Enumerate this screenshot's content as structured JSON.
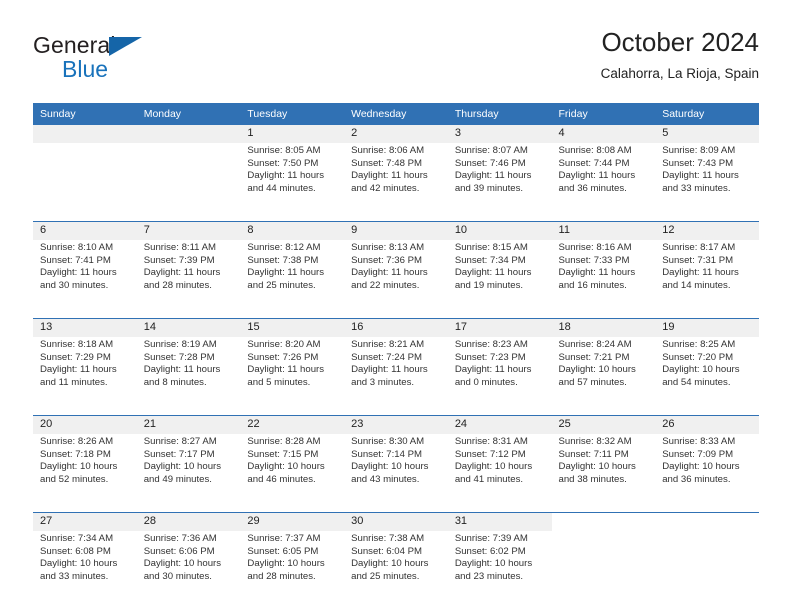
{
  "brand": {
    "word_one": "General",
    "word_two": "Blue",
    "triangle_icon": "triangle-icon",
    "colors": {
      "blue": "#1872bb",
      "triangle": "#1565a8",
      "dark": "#231f20"
    }
  },
  "header": {
    "title": "October 2024",
    "subtitle": "Calahorra, La Rioja, Spain"
  },
  "theme": {
    "header_blue": "#3071b4",
    "daynum_band": "#f0f0f0",
    "text": "#333333",
    "page_bg": "#ffffff"
  },
  "calendar": {
    "weekday_headers": [
      "Sunday",
      "Monday",
      "Tuesday",
      "Wednesday",
      "Thursday",
      "Friday",
      "Saturday"
    ],
    "weeks": [
      [
        {
          "day": "",
          "lines": []
        },
        {
          "day": "",
          "lines": []
        },
        {
          "day": "1",
          "lines": [
            "Sunrise: 8:05 AM",
            "Sunset: 7:50 PM",
            "Daylight: 11 hours",
            "and 44 minutes."
          ]
        },
        {
          "day": "2",
          "lines": [
            "Sunrise: 8:06 AM",
            "Sunset: 7:48 PM",
            "Daylight: 11 hours",
            "and 42 minutes."
          ]
        },
        {
          "day": "3",
          "lines": [
            "Sunrise: 8:07 AM",
            "Sunset: 7:46 PM",
            "Daylight: 11 hours",
            "and 39 minutes."
          ]
        },
        {
          "day": "4",
          "lines": [
            "Sunrise: 8:08 AM",
            "Sunset: 7:44 PM",
            "Daylight: 11 hours",
            "and 36 minutes."
          ]
        },
        {
          "day": "5",
          "lines": [
            "Sunrise: 8:09 AM",
            "Sunset: 7:43 PM",
            "Daylight: 11 hours",
            "and 33 minutes."
          ]
        }
      ],
      [
        {
          "day": "6",
          "lines": [
            "Sunrise: 8:10 AM",
            "Sunset: 7:41 PM",
            "Daylight: 11 hours",
            "and 30 minutes."
          ]
        },
        {
          "day": "7",
          "lines": [
            "Sunrise: 8:11 AM",
            "Sunset: 7:39 PM",
            "Daylight: 11 hours",
            "and 28 minutes."
          ]
        },
        {
          "day": "8",
          "lines": [
            "Sunrise: 8:12 AM",
            "Sunset: 7:38 PM",
            "Daylight: 11 hours",
            "and 25 minutes."
          ]
        },
        {
          "day": "9",
          "lines": [
            "Sunrise: 8:13 AM",
            "Sunset: 7:36 PM",
            "Daylight: 11 hours",
            "and 22 minutes."
          ]
        },
        {
          "day": "10",
          "lines": [
            "Sunrise: 8:15 AM",
            "Sunset: 7:34 PM",
            "Daylight: 11 hours",
            "and 19 minutes."
          ]
        },
        {
          "day": "11",
          "lines": [
            "Sunrise: 8:16 AM",
            "Sunset: 7:33 PM",
            "Daylight: 11 hours",
            "and 16 minutes."
          ]
        },
        {
          "day": "12",
          "lines": [
            "Sunrise: 8:17 AM",
            "Sunset: 7:31 PM",
            "Daylight: 11 hours",
            "and 14 minutes."
          ]
        }
      ],
      [
        {
          "day": "13",
          "lines": [
            "Sunrise: 8:18 AM",
            "Sunset: 7:29 PM",
            "Daylight: 11 hours",
            "and 11 minutes."
          ]
        },
        {
          "day": "14",
          "lines": [
            "Sunrise: 8:19 AM",
            "Sunset: 7:28 PM",
            "Daylight: 11 hours",
            "and 8 minutes."
          ]
        },
        {
          "day": "15",
          "lines": [
            "Sunrise: 8:20 AM",
            "Sunset: 7:26 PM",
            "Daylight: 11 hours",
            "and 5 minutes."
          ]
        },
        {
          "day": "16",
          "lines": [
            "Sunrise: 8:21 AM",
            "Sunset: 7:24 PM",
            "Daylight: 11 hours",
            "and 3 minutes."
          ]
        },
        {
          "day": "17",
          "lines": [
            "Sunrise: 8:23 AM",
            "Sunset: 7:23 PM",
            "Daylight: 11 hours",
            "and 0 minutes."
          ]
        },
        {
          "day": "18",
          "lines": [
            "Sunrise: 8:24 AM",
            "Sunset: 7:21 PM",
            "Daylight: 10 hours",
            "and 57 minutes."
          ]
        },
        {
          "day": "19",
          "lines": [
            "Sunrise: 8:25 AM",
            "Sunset: 7:20 PM",
            "Daylight: 10 hours",
            "and 54 minutes."
          ]
        }
      ],
      [
        {
          "day": "20",
          "lines": [
            "Sunrise: 8:26 AM",
            "Sunset: 7:18 PM",
            "Daylight: 10 hours",
            "and 52 minutes."
          ]
        },
        {
          "day": "21",
          "lines": [
            "Sunrise: 8:27 AM",
            "Sunset: 7:17 PM",
            "Daylight: 10 hours",
            "and 49 minutes."
          ]
        },
        {
          "day": "22",
          "lines": [
            "Sunrise: 8:28 AM",
            "Sunset: 7:15 PM",
            "Daylight: 10 hours",
            "and 46 minutes."
          ]
        },
        {
          "day": "23",
          "lines": [
            "Sunrise: 8:30 AM",
            "Sunset: 7:14 PM",
            "Daylight: 10 hours",
            "and 43 minutes."
          ]
        },
        {
          "day": "24",
          "lines": [
            "Sunrise: 8:31 AM",
            "Sunset: 7:12 PM",
            "Daylight: 10 hours",
            "and 41 minutes."
          ]
        },
        {
          "day": "25",
          "lines": [
            "Sunrise: 8:32 AM",
            "Sunset: 7:11 PM",
            "Daylight: 10 hours",
            "and 38 minutes."
          ]
        },
        {
          "day": "26",
          "lines": [
            "Sunrise: 8:33 AM",
            "Sunset: 7:09 PM",
            "Daylight: 10 hours",
            "and 36 minutes."
          ]
        }
      ],
      [
        {
          "day": "27",
          "lines": [
            "Sunrise: 7:34 AM",
            "Sunset: 6:08 PM",
            "Daylight: 10 hours",
            "and 33 minutes."
          ]
        },
        {
          "day": "28",
          "lines": [
            "Sunrise: 7:36 AM",
            "Sunset: 6:06 PM",
            "Daylight: 10 hours",
            "and 30 minutes."
          ]
        },
        {
          "day": "29",
          "lines": [
            "Sunrise: 7:37 AM",
            "Sunset: 6:05 PM",
            "Daylight: 10 hours",
            "and 28 minutes."
          ]
        },
        {
          "day": "30",
          "lines": [
            "Sunrise: 7:38 AM",
            "Sunset: 6:04 PM",
            "Daylight: 10 hours",
            "and 25 minutes."
          ]
        },
        {
          "day": "31",
          "lines": [
            "Sunrise: 7:39 AM",
            "Sunset: 6:02 PM",
            "Daylight: 10 hours",
            "and 23 minutes."
          ]
        },
        {
          "day": "",
          "lines": []
        },
        {
          "day": "",
          "lines": []
        }
      ]
    ]
  }
}
